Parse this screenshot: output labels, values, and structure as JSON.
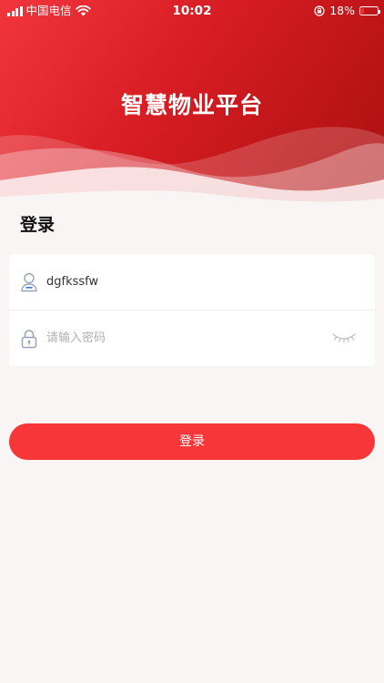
{
  "statusbar": {
    "carrier": "中国电信",
    "time": "10:02",
    "battery_percent": "18%",
    "battery_level": 0.18,
    "icons": [
      "signal-icon",
      "wifi-icon",
      "orientation-lock-icon",
      "battery-icon"
    ]
  },
  "header": {
    "title": "智慧物业平台"
  },
  "login": {
    "heading": "登录",
    "username_value": "dgfkssfw",
    "password_placeholder": "请输入密码",
    "submit_label": "登录",
    "icons": [
      "user-icon",
      "lock-icon",
      "eye-closed-icon"
    ]
  },
  "colors": {
    "primary": "#f7363a",
    "header_gradient_start": "#f2353d",
    "header_gradient_end": "#a80f0f",
    "background": "#faf5f5",
    "icon_gray": "#9aa3b5"
  }
}
